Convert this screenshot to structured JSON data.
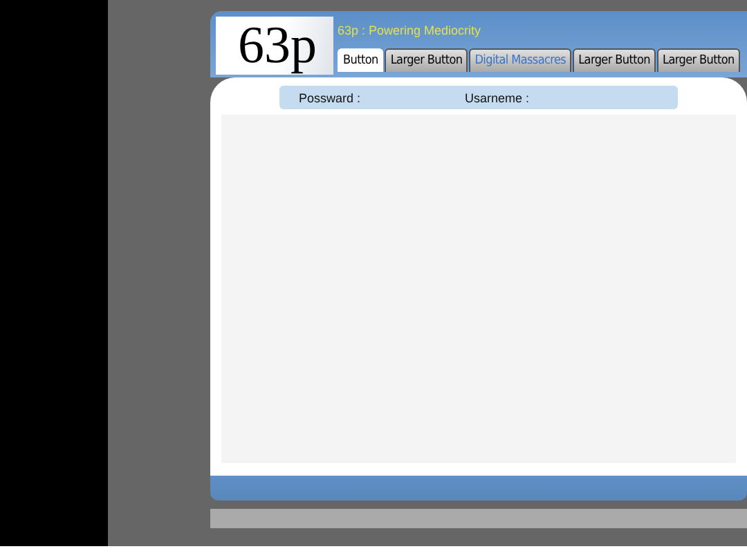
{
  "logo": "63p",
  "tagline": "63p : Powering Mediocrity",
  "tabs": [
    {
      "label": "Button",
      "selected": true,
      "color": "#000000"
    },
    {
      "label": "Larger Button",
      "selected": false,
      "color": "#000000"
    },
    {
      "label": "Digital Massacres",
      "selected": false,
      "color": "#3a73c4"
    },
    {
      "label": "Larger Button",
      "selected": false,
      "color": "#000000"
    },
    {
      "label": "Larger Button",
      "selected": false,
      "color": "#000000"
    }
  ],
  "login": {
    "password_label": "Possward :",
    "username_label": "Usarneme :"
  }
}
